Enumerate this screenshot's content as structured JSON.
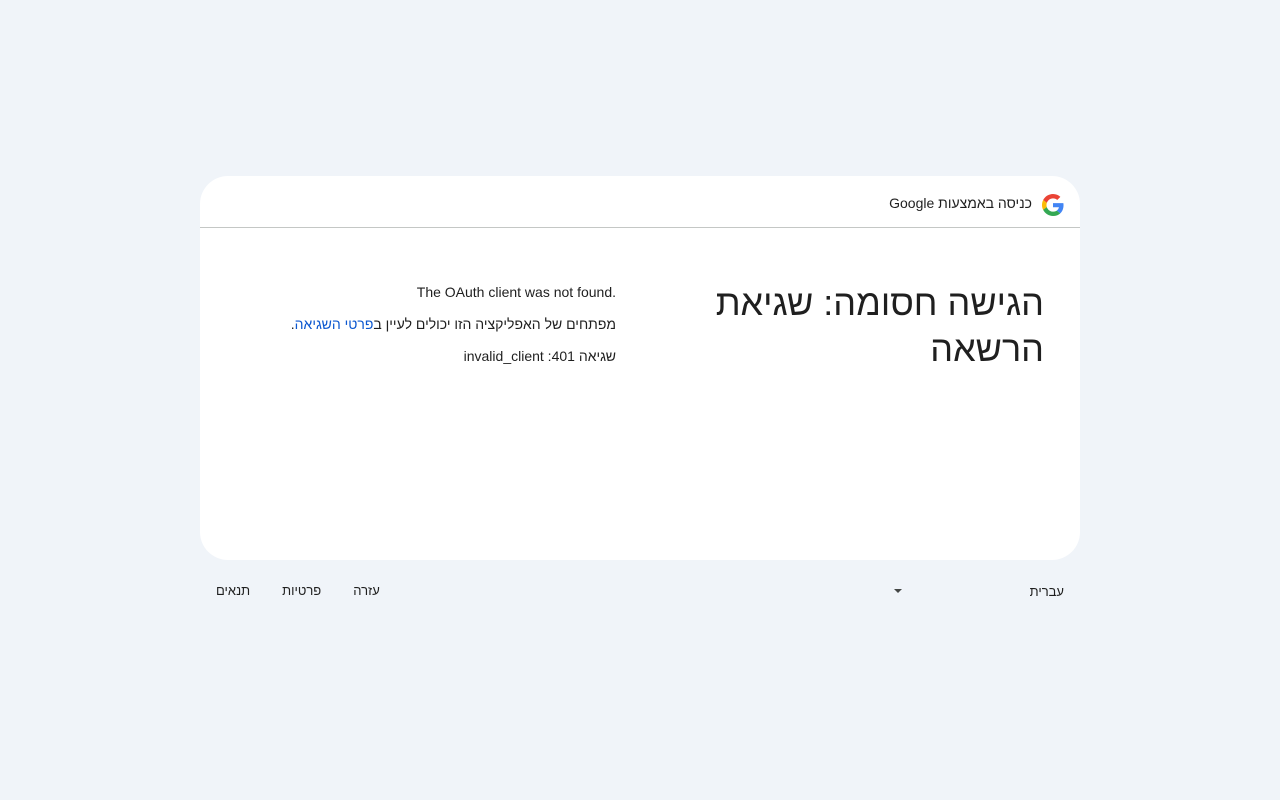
{
  "header": {
    "title": "כניסה באמצעות Google",
    "logo_icon": "google-g-logo-icon"
  },
  "main": {
    "headline": "הגישה חסומה: שגיאת הרשאה",
    "message": "The OAuth client was not found.",
    "developer_text": "מפתחים של האפליקציה הזו יכולים לעיין ב",
    "error_details_link": "פרטי השגיאה",
    "trailing_period": ".",
    "error_code": "שגיאה 401: invalid_client"
  },
  "footer": {
    "language": "עברית",
    "dropdown_icon": "caret-down-icon",
    "links": {
      "help": "עזרה",
      "privacy": "פרטיות",
      "terms": "תנאים"
    }
  },
  "colors": {
    "background": "#f0f4f9",
    "card": "#ffffff",
    "link": "#0b57d0",
    "text": "#1f1f1f"
  }
}
